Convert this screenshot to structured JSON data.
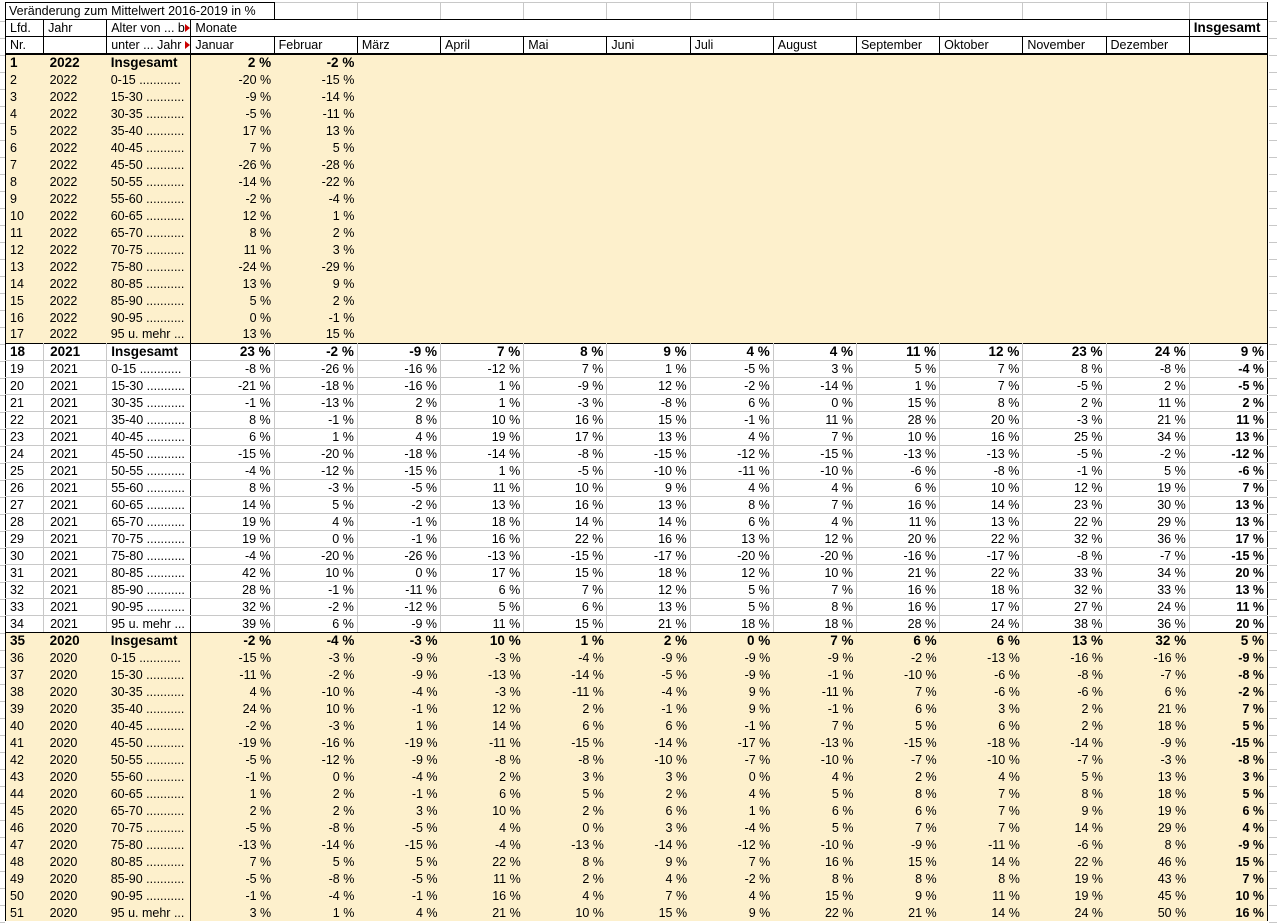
{
  "title": "Veränderung zum Mittelwert 2016-2019 in %",
  "header": {
    "lfd": "Lfd.",
    "nr": "Nr.",
    "jahr": "Jahr",
    "alter_line1": "Alter von ... b",
    "alter_line2": "unter ... Jahr",
    "monate": "Monate",
    "insgesamt": "Insgesamt",
    "months": [
      "Januar",
      "Februar",
      "März",
      "April",
      "Mai",
      "Juni",
      "Juli",
      "August",
      "September",
      "Oktober",
      "November",
      "Dezember"
    ]
  },
  "colors": {
    "block_highlight": "#FDF0CC",
    "grid_line": "#C8C8C8",
    "truncation_marker": "#CC0000",
    "border": "#000000"
  },
  "rows": [
    {
      "nr": "1",
      "jahr": "2022",
      "alter": "Insgesamt",
      "bold": true,
      "values": [
        "2 %",
        "-2 %"
      ]
    },
    {
      "nr": "2",
      "jahr": "2022",
      "alter": "0-15 ............",
      "values": [
        "-20 %",
        "-15 %"
      ]
    },
    {
      "nr": "3",
      "jahr": "2022",
      "alter": "15-30 ...........",
      "values": [
        "-9 %",
        "-14 %"
      ]
    },
    {
      "nr": "4",
      "jahr": "2022",
      "alter": "30-35 ...........",
      "values": [
        "-5 %",
        "-11 %"
      ]
    },
    {
      "nr": "5",
      "jahr": "2022",
      "alter": "35-40 ...........",
      "values": [
        "17 %",
        "13 %"
      ]
    },
    {
      "nr": "6",
      "jahr": "2022",
      "alter": "40-45 ...........",
      "values": [
        "7 %",
        "5 %"
      ]
    },
    {
      "nr": "7",
      "jahr": "2022",
      "alter": "45-50 ...........",
      "values": [
        "-26 %",
        "-28 %"
      ]
    },
    {
      "nr": "8",
      "jahr": "2022",
      "alter": "50-55 ...........",
      "values": [
        "-14 %",
        "-22 %"
      ]
    },
    {
      "nr": "9",
      "jahr": "2022",
      "alter": "55-60 ...........",
      "values": [
        "-2 %",
        "-4 %"
      ]
    },
    {
      "nr": "10",
      "jahr": "2022",
      "alter": "60-65 ...........",
      "values": [
        "12 %",
        "1 %"
      ]
    },
    {
      "nr": "11",
      "jahr": "2022",
      "alter": "65-70 ...........",
      "values": [
        "8 %",
        "2 %"
      ]
    },
    {
      "nr": "12",
      "jahr": "2022",
      "alter": "70-75 ...........",
      "values": [
        "11 %",
        "3 %"
      ]
    },
    {
      "nr": "13",
      "jahr": "2022",
      "alter": "75-80 ...........",
      "values": [
        "-24 %",
        "-29 %"
      ]
    },
    {
      "nr": "14",
      "jahr": "2022",
      "alter": "80-85 ...........",
      "values": [
        "13 %",
        "9 %"
      ]
    },
    {
      "nr": "15",
      "jahr": "2022",
      "alter": "85-90 ...........",
      "values": [
        "5 %",
        "2 %"
      ]
    },
    {
      "nr": "16",
      "jahr": "2022",
      "alter": "90-95 ...........",
      "values": [
        "0 %",
        "-1 %"
      ]
    },
    {
      "nr": "17",
      "jahr": "2022",
      "alter": "95 u. mehr ...",
      "values": [
        "13 %",
        "15 %"
      ]
    },
    {
      "nr": "18",
      "jahr": "2021",
      "alter": "Insgesamt",
      "bold": true,
      "values": [
        "23 %",
        "-2 %",
        "-9 %",
        "7 %",
        "8 %",
        "9 %",
        "4 %",
        "4 %",
        "11 %",
        "12 %",
        "23 %",
        "24 %",
        "9 %"
      ]
    },
    {
      "nr": "19",
      "jahr": "2021",
      "alter": "0-15 ............",
      "values": [
        "-8 %",
        "-26 %",
        "-16 %",
        "-12 %",
        "7 %",
        "1 %",
        "-5 %",
        "3 %",
        "5 %",
        "7 %",
        "8 %",
        "-8 %",
        "-4 %"
      ]
    },
    {
      "nr": "20",
      "jahr": "2021",
      "alter": "15-30 ...........",
      "values": [
        "-21 %",
        "-18 %",
        "-16 %",
        "1 %",
        "-9 %",
        "12 %",
        "-2 %",
        "-14 %",
        "1 %",
        "7 %",
        "-5 %",
        "2 %",
        "-5 %"
      ]
    },
    {
      "nr": "21",
      "jahr": "2021",
      "alter": "30-35 ...........",
      "values": [
        "-1 %",
        "-13 %",
        "2 %",
        "1 %",
        "-3 %",
        "-8 %",
        "6 %",
        "0 %",
        "15 %",
        "8 %",
        "2 %",
        "11 %",
        "2 %"
      ]
    },
    {
      "nr": "22",
      "jahr": "2021",
      "alter": "35-40 ...........",
      "values": [
        "8 %",
        "-1 %",
        "8 %",
        "10 %",
        "16 %",
        "15 %",
        "-1 %",
        "11 %",
        "28 %",
        "20 %",
        "-3 %",
        "21 %",
        "11 %"
      ]
    },
    {
      "nr": "23",
      "jahr": "2021",
      "alter": "40-45 ...........",
      "values": [
        "6 %",
        "1 %",
        "4 %",
        "19 %",
        "17 %",
        "13 %",
        "4 %",
        "7 %",
        "10 %",
        "16 %",
        "25 %",
        "34 %",
        "13 %"
      ]
    },
    {
      "nr": "24",
      "jahr": "2021",
      "alter": "45-50 ...........",
      "values": [
        "-15 %",
        "-20 %",
        "-18 %",
        "-14 %",
        "-8 %",
        "-15 %",
        "-12 %",
        "-15 %",
        "-13 %",
        "-13 %",
        "-5 %",
        "-2 %",
        "-12 %"
      ]
    },
    {
      "nr": "25",
      "jahr": "2021",
      "alter": "50-55 ...........",
      "values": [
        "-4 %",
        "-12 %",
        "-15 %",
        "1 %",
        "-5 %",
        "-10 %",
        "-11 %",
        "-10 %",
        "-6 %",
        "-8 %",
        "-1 %",
        "5 %",
        "-6 %"
      ]
    },
    {
      "nr": "26",
      "jahr": "2021",
      "alter": "55-60 ...........",
      "values": [
        "8 %",
        "-3 %",
        "-5 %",
        "11 %",
        "10 %",
        "9 %",
        "4 %",
        "4 %",
        "6 %",
        "10 %",
        "12 %",
        "19 %",
        "7 %"
      ]
    },
    {
      "nr": "27",
      "jahr": "2021",
      "alter": "60-65 ...........",
      "values": [
        "14 %",
        "5 %",
        "-2 %",
        "13 %",
        "16 %",
        "13 %",
        "8 %",
        "7 %",
        "16 %",
        "14 %",
        "23 %",
        "30 %",
        "13 %"
      ]
    },
    {
      "nr": "28",
      "jahr": "2021",
      "alter": "65-70 ...........",
      "values": [
        "19 %",
        "4 %",
        "-1 %",
        "18 %",
        "14 %",
        "14 %",
        "6 %",
        "4 %",
        "11 %",
        "13 %",
        "22 %",
        "29 %",
        "13 %"
      ]
    },
    {
      "nr": "29",
      "jahr": "2021",
      "alter": "70-75 ...........",
      "values": [
        "19 %",
        "0 %",
        "-1 %",
        "16 %",
        "22 %",
        "16 %",
        "13 %",
        "12 %",
        "20 %",
        "22 %",
        "32 %",
        "36 %",
        "17 %"
      ]
    },
    {
      "nr": "30",
      "jahr": "2021",
      "alter": "75-80 ...........",
      "values": [
        "-4 %",
        "-20 %",
        "-26 %",
        "-13 %",
        "-15 %",
        "-17 %",
        "-20 %",
        "-20 %",
        "-16 %",
        "-17 %",
        "-8 %",
        "-7 %",
        "-15 %"
      ]
    },
    {
      "nr": "31",
      "jahr": "2021",
      "alter": "80-85 ...........",
      "values": [
        "42 %",
        "10 %",
        "0 %",
        "17 %",
        "15 %",
        "18 %",
        "12 %",
        "10 %",
        "21 %",
        "22 %",
        "33 %",
        "34 %",
        "20 %"
      ]
    },
    {
      "nr": "32",
      "jahr": "2021",
      "alter": "85-90 ...........",
      "values": [
        "28 %",
        "-1 %",
        "-11 %",
        "6 %",
        "7 %",
        "12 %",
        "5 %",
        "7 %",
        "16 %",
        "18 %",
        "32 %",
        "33 %",
        "13 %"
      ]
    },
    {
      "nr": "33",
      "jahr": "2021",
      "alter": "90-95 ...........",
      "values": [
        "32 %",
        "-2 %",
        "-12 %",
        "5 %",
        "6 %",
        "13 %",
        "5 %",
        "8 %",
        "16 %",
        "17 %",
        "27 %",
        "24 %",
        "11 %"
      ]
    },
    {
      "nr": "34",
      "jahr": "2021",
      "alter": "95 u. mehr ...",
      "values": [
        "39 %",
        "6 %",
        "-9 %",
        "11 %",
        "15 %",
        "21 %",
        "18 %",
        "18 %",
        "28 %",
        "24 %",
        "38 %",
        "36 %",
        "20 %"
      ]
    },
    {
      "nr": "35",
      "jahr": "2020",
      "alter": "Insgesamt",
      "bold": true,
      "values": [
        "-2 %",
        "-4 %",
        "-3 %",
        "10 %",
        "1 %",
        "2 %",
        "0 %",
        "7 %",
        "6 %",
        "6 %",
        "13 %",
        "32 %",
        "5 %"
      ]
    },
    {
      "nr": "36",
      "jahr": "2020",
      "alter": "0-15 ............",
      "values": [
        "-15 %",
        "-3 %",
        "-9 %",
        "-3 %",
        "-4 %",
        "-9 %",
        "-9 %",
        "-9 %",
        "-2 %",
        "-13 %",
        "-16 %",
        "-16 %",
        "-9 %"
      ]
    },
    {
      "nr": "37",
      "jahr": "2020",
      "alter": "15-30 ...........",
      "values": [
        "-11 %",
        "-2 %",
        "-9 %",
        "-13 %",
        "-14 %",
        "-5 %",
        "-9 %",
        "-1 %",
        "-10 %",
        "-6 %",
        "-8 %",
        "-7 %",
        "-8 %"
      ]
    },
    {
      "nr": "38",
      "jahr": "2020",
      "alter": "30-35 ...........",
      "values": [
        "4 %",
        "-10 %",
        "-4 %",
        "-3 %",
        "-11 %",
        "-4 %",
        "9 %",
        "-11 %",
        "7 %",
        "-6 %",
        "-6 %",
        "6 %",
        "-2 %"
      ]
    },
    {
      "nr": "39",
      "jahr": "2020",
      "alter": "35-40 ...........",
      "values": [
        "24 %",
        "10 %",
        "-1 %",
        "12 %",
        "2 %",
        "-1 %",
        "9 %",
        "-1 %",
        "6 %",
        "3 %",
        "2 %",
        "21 %",
        "7 %"
      ]
    },
    {
      "nr": "40",
      "jahr": "2020",
      "alter": "40-45 ...........",
      "values": [
        "-2 %",
        "-3 %",
        "1 %",
        "14 %",
        "6 %",
        "6 %",
        "-1 %",
        "7 %",
        "5 %",
        "6 %",
        "2 %",
        "18 %",
        "5 %"
      ]
    },
    {
      "nr": "41",
      "jahr": "2020",
      "alter": "45-50 ...........",
      "values": [
        "-19 %",
        "-16 %",
        "-19 %",
        "-11 %",
        "-15 %",
        "-14 %",
        "-17 %",
        "-13 %",
        "-15 %",
        "-18 %",
        "-14 %",
        "-9 %",
        "-15 %"
      ]
    },
    {
      "nr": "42",
      "jahr": "2020",
      "alter": "50-55 ...........",
      "values": [
        "-5 %",
        "-12 %",
        "-9 %",
        "-8 %",
        "-8 %",
        "-10 %",
        "-7 %",
        "-10 %",
        "-7 %",
        "-10 %",
        "-7 %",
        "-3 %",
        "-8 %"
      ]
    },
    {
      "nr": "43",
      "jahr": "2020",
      "alter": "55-60 ...........",
      "values": [
        "-1 %",
        "0 %",
        "-4 %",
        "2 %",
        "3 %",
        "3 %",
        "0 %",
        "4 %",
        "2 %",
        "4 %",
        "5 %",
        "13 %",
        "3 %"
      ]
    },
    {
      "nr": "44",
      "jahr": "2020",
      "alter": "60-65 ...........",
      "values": [
        "1 %",
        "2 %",
        "-1 %",
        "6 %",
        "5 %",
        "2 %",
        "4 %",
        "5 %",
        "8 %",
        "7 %",
        "8 %",
        "18 %",
        "5 %"
      ]
    },
    {
      "nr": "45",
      "jahr": "2020",
      "alter": "65-70 ...........",
      "values": [
        "2 %",
        "2 %",
        "3 %",
        "10 %",
        "2 %",
        "6 %",
        "1 %",
        "6 %",
        "6 %",
        "7 %",
        "9 %",
        "19 %",
        "6 %"
      ]
    },
    {
      "nr": "46",
      "jahr": "2020",
      "alter": "70-75 ...........",
      "values": [
        "-5 %",
        "-8 %",
        "-5 %",
        "4 %",
        "0 %",
        "3 %",
        "-4 %",
        "5 %",
        "7 %",
        "7 %",
        "14 %",
        "29 %",
        "4 %"
      ]
    },
    {
      "nr": "47",
      "jahr": "2020",
      "alter": "75-80 ...........",
      "values": [
        "-13 %",
        "-14 %",
        "-15 %",
        "-4 %",
        "-13 %",
        "-14 %",
        "-12 %",
        "-10 %",
        "-9 %",
        "-11 %",
        "-6 %",
        "8 %",
        "-9 %"
      ]
    },
    {
      "nr": "48",
      "jahr": "2020",
      "alter": "80-85 ...........",
      "values": [
        "7 %",
        "5 %",
        "5 %",
        "22 %",
        "8 %",
        "9 %",
        "7 %",
        "16 %",
        "15 %",
        "14 %",
        "22 %",
        "46 %",
        "15 %"
      ]
    },
    {
      "nr": "49",
      "jahr": "2020",
      "alter": "85-90 ...........",
      "values": [
        "-5 %",
        "-8 %",
        "-5 %",
        "11 %",
        "2 %",
        "4 %",
        "-2 %",
        "8 %",
        "8 %",
        "8 %",
        "19 %",
        "43 %",
        "7 %"
      ]
    },
    {
      "nr": "50",
      "jahr": "2020",
      "alter": "90-95 ...........",
      "values": [
        "-1 %",
        "-4 %",
        "-1 %",
        "16 %",
        "4 %",
        "7 %",
        "4 %",
        "15 %",
        "9 %",
        "11 %",
        "19 %",
        "45 %",
        "10 %"
      ]
    },
    {
      "nr": "51",
      "jahr": "2020",
      "alter": "95 u. mehr ...",
      "values": [
        "3 %",
        "1 %",
        "4 %",
        "21 %",
        "10 %",
        "15 %",
        "9 %",
        "22 %",
        "21 %",
        "14 %",
        "24 %",
        "50 %",
        "16 %"
      ]
    }
  ]
}
